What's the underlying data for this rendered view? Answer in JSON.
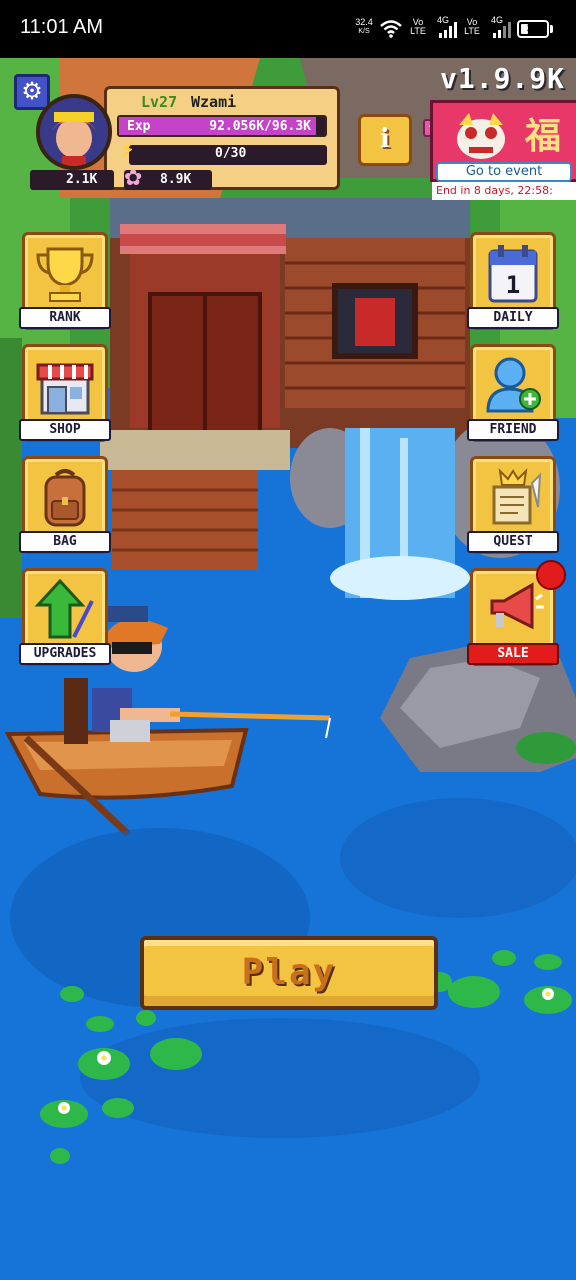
{
  "status_bar": {
    "time": "11:01 AM",
    "net_speed": "32.4",
    "net_unit": "K/S",
    "sim1_top": "Vo",
    "sim1_bottom": "LTE",
    "sim1_gen": "4G",
    "sim2_top": "Vo",
    "sim2_bottom": "LTE",
    "sim2_gen": "4G",
    "battery_level": "38",
    "battery_fraction": 0.38
  },
  "version": "v1.9.9K",
  "profile": {
    "level": "Lv27",
    "name": "Wzami",
    "exp_label": "Exp",
    "exp_value": "92.056K/96.3K",
    "exp_fraction": 0.956,
    "energy_value": "0/30",
    "coins": "2.1K",
    "flowers": "8.9K"
  },
  "info_button": "i",
  "event": {
    "banner_glyph": "福",
    "button_label": "Go to event",
    "countdown": "End in 8 days, 22:58:"
  },
  "menu_left": [
    {
      "label": "RANK",
      "icon": "trophy-icon"
    },
    {
      "label": "SHOP",
      "icon": "shop-icon"
    },
    {
      "label": "BAG",
      "icon": "backpack-icon"
    },
    {
      "label": "UPGRADES",
      "icon": "upgrade-arrow-icon"
    }
  ],
  "menu_right": [
    {
      "label": "DAILY",
      "icon": "calendar-icon",
      "calendar_day": "1"
    },
    {
      "label": "FRIEND",
      "icon": "add-friend-icon"
    },
    {
      "label": "QUEST",
      "icon": "scroll-icon"
    },
    {
      "label": "SALE",
      "icon": "megaphone-icon"
    }
  ],
  "play_label": "Play",
  "colors": {
    "water": "#1673d8",
    "button_gold": "#f3c441",
    "button_border": "#8a4a12",
    "exp_bar": "#c443c9",
    "notification": "#e21b1b"
  }
}
